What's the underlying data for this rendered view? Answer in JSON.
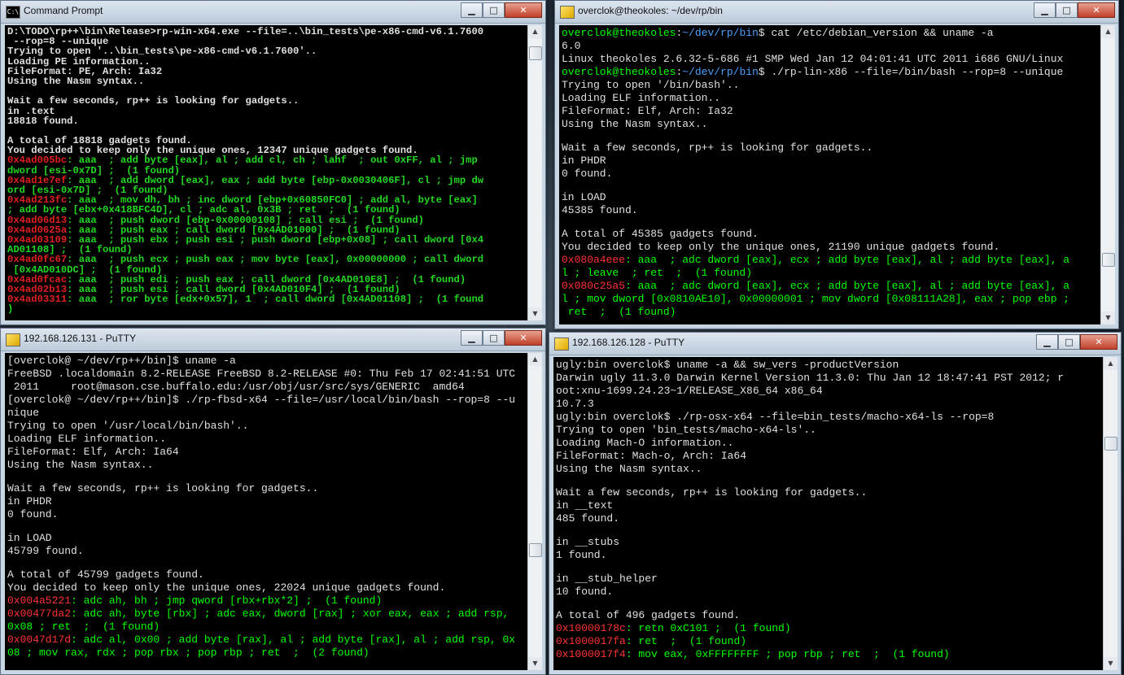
{
  "windows": {
    "cmd": {
      "title": "Command Prompt",
      "lines": [
        [
          [
            "w",
            "D:\\TODO\\rp++\\bin\\Release>rp-win-x64.exe --file=..\\bin_tests\\pe-x86-cmd-v6.1.7600"
          ]
        ],
        [
          [
            "w",
            " --rop=8 --unique"
          ]
        ],
        [
          [
            "w",
            "Trying to open '..\\bin_tests\\pe-x86-cmd-v6.1.7600'.."
          ]
        ],
        [
          [
            "w",
            "Loading PE information.."
          ]
        ],
        [
          [
            "w",
            "FileFormat: PE, Arch: Ia32"
          ]
        ],
        [
          [
            "w",
            "Using the Nasm syntax.."
          ]
        ],
        [
          [
            "w",
            ""
          ]
        ],
        [
          [
            "w",
            "Wait a few seconds, rp++ is looking for gadgets.."
          ]
        ],
        [
          [
            "w",
            "in .text"
          ]
        ],
        [
          [
            "w",
            "18818 found."
          ]
        ],
        [
          [
            "w",
            ""
          ]
        ],
        [
          [
            "w",
            "A total of 18818 gadgets found."
          ]
        ],
        [
          [
            "w",
            "You decided to keep only the unique ones, 12347 unique gadgets found."
          ]
        ],
        [
          [
            "cr",
            "0x4ad005bc"
          ],
          [
            "cg",
            ": aaa  ; add byte [eax], al ; add cl, ch ; lahf  ; out 0xFF, al ; jmp"
          ]
        ],
        [
          [
            "cg",
            "dword [esi-0x7D] ;  (1 found)"
          ]
        ],
        [
          [
            "cr",
            "0x4ad1e7ef"
          ],
          [
            "cg",
            ": aaa  ; add dword [eax], eax ; add byte [ebp-0x0030406F], cl ; jmp dw"
          ]
        ],
        [
          [
            "cg",
            "ord [esi-0x7D] ;  (1 found)"
          ]
        ],
        [
          [
            "cr",
            "0x4ad213fc"
          ],
          [
            "cg",
            ": aaa  ; mov dh, bh ; inc dword [ebp+0x60850FC0] ; add al, byte [eax]"
          ]
        ],
        [
          [
            "cg",
            "; add byte [ebx+0x418BFC4D], cl ; adc al, 0x3B ; ret  ;  (1 found)"
          ]
        ],
        [
          [
            "cr",
            "0x4ad06d13"
          ],
          [
            "cg",
            ": aaa  ; push dword [ebp-0x00000108] ; call esi ;  (1 found)"
          ]
        ],
        [
          [
            "cr",
            "0x4ad0625a"
          ],
          [
            "cg",
            ": aaa  ; push eax ; call dword [0x4AD01000] ;  (1 found)"
          ]
        ],
        [
          [
            "cr",
            "0x4ad03109"
          ],
          [
            "cg",
            ": aaa  ; push ebx ; push esi ; push dword [ebp+0x08] ; call dword [0x4"
          ]
        ],
        [
          [
            "cg",
            "AD01108] ;  (1 found)"
          ]
        ],
        [
          [
            "cr",
            "0x4ad0fc67"
          ],
          [
            "cg",
            ": aaa  ; push ecx ; push eax ; mov byte [eax], 0x00000000 ; call dword"
          ]
        ],
        [
          [
            "cg",
            " [0x4AD010DC] ;  (1 found)"
          ]
        ],
        [
          [
            "cr",
            "0x4ad0fcac"
          ],
          [
            "cg",
            ": aaa  ; push edi ; push eax ; call dword [0x4AD010E8] ;  (1 found)"
          ]
        ],
        [
          [
            "cr",
            "0x4ad02b13"
          ],
          [
            "cg",
            ": aaa  ; push esi ; call dword [0x4AD010F4] ;  (1 found)"
          ]
        ],
        [
          [
            "cr",
            "0x4ad03311"
          ],
          [
            "cg",
            ": aaa  ; ror byte [edx+0x57], 1  ; call dword [0x4AD01108] ;  (1 found"
          ]
        ],
        [
          [
            "cg",
            ")"
          ]
        ]
      ]
    },
    "linux": {
      "title": "overclok@theokoles: ~/dev/rp/bin",
      "lines": [
        [
          [
            "g",
            "overclok@theokoles"
          ],
          [
            "w",
            ":"
          ],
          [
            "b",
            "~/dev/rp/bin"
          ],
          [
            "w",
            "$ cat /etc/debian_version && uname -a"
          ]
        ],
        [
          [
            "w",
            "6.0"
          ]
        ],
        [
          [
            "w",
            "Linux theokoles 2.6.32-5-686 #1 SMP Wed Jan 12 04:01:41 UTC 2011 i686 GNU/Linux"
          ]
        ],
        [
          [
            "g",
            "overclok@theokoles"
          ],
          [
            "w",
            ":"
          ],
          [
            "b",
            "~/dev/rp/bin"
          ],
          [
            "w",
            "$ ./rp-lin-x86 --file=/bin/bash --rop=8 --unique"
          ]
        ],
        [
          [
            "w",
            "Trying to open '/bin/bash'.."
          ]
        ],
        [
          [
            "w",
            "Loading ELF information.."
          ]
        ],
        [
          [
            "w",
            "FileFormat: Elf, Arch: Ia32"
          ]
        ],
        [
          [
            "w",
            "Using the Nasm syntax.."
          ]
        ],
        [
          [
            "w",
            ""
          ]
        ],
        [
          [
            "w",
            "Wait a few seconds, rp++ is looking for gadgets.."
          ]
        ],
        [
          [
            "w",
            "in PHDR"
          ]
        ],
        [
          [
            "w",
            "0 found."
          ]
        ],
        [
          [
            "w",
            ""
          ]
        ],
        [
          [
            "w",
            "in LOAD"
          ]
        ],
        [
          [
            "w",
            "45385 found."
          ]
        ],
        [
          [
            "w",
            ""
          ]
        ],
        [
          [
            "w",
            "A total of 45385 gadgets found."
          ]
        ],
        [
          [
            "w",
            "You decided to keep only the unique ones, 21190 unique gadgets found."
          ]
        ],
        [
          [
            "r",
            "0x080a4eee"
          ],
          [
            "g",
            ": aaa  ; adc dword [eax], ecx ; add byte [eax], al ; add byte [eax], a"
          ]
        ],
        [
          [
            "g",
            "l ; leave  ; ret  ;  (1 found)"
          ]
        ],
        [
          [
            "r",
            "0x080c25a5"
          ],
          [
            "g",
            ": aaa  ; adc dword [eax], ecx ; add byte [eax], al ; add byte [eax], a"
          ]
        ],
        [
          [
            "g",
            "l ; mov dword [0x0810AE10], 0x00000001 ; mov dword [0x08111A28], eax ; pop ebp ;"
          ]
        ],
        [
          [
            "g",
            " ret  ;  (1 found)"
          ]
        ]
      ]
    },
    "bsd": {
      "title": "192.168.126.131 - PuTTY",
      "lines": [
        [
          [
            "w",
            "[overclok@ ~/dev/rp++/bin]$ uname -a"
          ]
        ],
        [
          [
            "w",
            "FreeBSD .localdomain 8.2-RELEASE FreeBSD 8.2-RELEASE #0: Thu Feb 17 02:41:51 UTC"
          ]
        ],
        [
          [
            "w",
            " 2011     root@mason.cse.buffalo.edu:/usr/obj/usr/src/sys/GENERIC  amd64"
          ]
        ],
        [
          [
            "w",
            "[overclok@ ~/dev/rp++/bin]$ ./rp-fbsd-x64 --file=/usr/local/bin/bash --rop=8 --u"
          ]
        ],
        [
          [
            "w",
            "nique"
          ]
        ],
        [
          [
            "w",
            "Trying to open '/usr/local/bin/bash'.."
          ]
        ],
        [
          [
            "w",
            "Loading ELF information.."
          ]
        ],
        [
          [
            "w",
            "FileFormat: Elf, Arch: Ia64"
          ]
        ],
        [
          [
            "w",
            "Using the Nasm syntax.."
          ]
        ],
        [
          [
            "w",
            ""
          ]
        ],
        [
          [
            "w",
            "Wait a few seconds, rp++ is looking for gadgets.."
          ]
        ],
        [
          [
            "w",
            "in PHDR"
          ]
        ],
        [
          [
            "w",
            "0 found."
          ]
        ],
        [
          [
            "w",
            ""
          ]
        ],
        [
          [
            "w",
            "in LOAD"
          ]
        ],
        [
          [
            "w",
            "45799 found."
          ]
        ],
        [
          [
            "w",
            ""
          ]
        ],
        [
          [
            "w",
            "A total of 45799 gadgets found."
          ]
        ],
        [
          [
            "w",
            "You decided to keep only the unique ones, 22024 unique gadgets found."
          ]
        ],
        [
          [
            "r",
            "0x004a5221"
          ],
          [
            "g",
            ": adc ah, bh ; jmp qword [rbx+rbx*2] ;  (1 found)"
          ]
        ],
        [
          [
            "r",
            "0x00477da2"
          ],
          [
            "g",
            ": adc ah, byte [rbx] ; adc eax, dword [rax] ; xor eax, eax ; add rsp,"
          ]
        ],
        [
          [
            "g",
            "0x08 ; ret  ;  (1 found)"
          ]
        ],
        [
          [
            "r",
            "0x0047d17d"
          ],
          [
            "g",
            ": adc al, 0x00 ; add byte [rax], al ; add byte [rax], al ; add rsp, 0x"
          ]
        ],
        [
          [
            "g",
            "08 ; mov rax, rdx ; pop rbx ; pop rbp ; ret  ;  (2 found)"
          ]
        ]
      ]
    },
    "osx": {
      "title": "192.168.126.128 - PuTTY",
      "lines": [
        [
          [
            "w",
            "ugly:bin overclok$ uname -a && sw_vers -productVersion"
          ]
        ],
        [
          [
            "w",
            "Darwin ugly 11.3.0 Darwin Kernel Version 11.3.0: Thu Jan 12 18:47:41 PST 2012; r"
          ]
        ],
        [
          [
            "w",
            "oot:xnu-1699.24.23~1/RELEASE_X86_64 x86_64"
          ]
        ],
        [
          [
            "w",
            "10.7.3"
          ]
        ],
        [
          [
            "w",
            "ugly:bin overclok$ ./rp-osx-x64 --file=bin_tests/macho-x64-ls --rop=8"
          ]
        ],
        [
          [
            "w",
            "Trying to open 'bin_tests/macho-x64-ls'.."
          ]
        ],
        [
          [
            "w",
            "Loading Mach-O information.."
          ]
        ],
        [
          [
            "w",
            "FileFormat: Mach-o, Arch: Ia64"
          ]
        ],
        [
          [
            "w",
            "Using the Nasm syntax.."
          ]
        ],
        [
          [
            "w",
            ""
          ]
        ],
        [
          [
            "w",
            "Wait a few seconds, rp++ is looking for gadgets.."
          ]
        ],
        [
          [
            "w",
            "in __text"
          ]
        ],
        [
          [
            "w",
            "485 found."
          ]
        ],
        [
          [
            "w",
            ""
          ]
        ],
        [
          [
            "w",
            "in __stubs"
          ]
        ],
        [
          [
            "w",
            "1 found."
          ]
        ],
        [
          [
            "w",
            ""
          ]
        ],
        [
          [
            "w",
            "in __stub_helper"
          ]
        ],
        [
          [
            "w",
            "10 found."
          ]
        ],
        [
          [
            "w",
            ""
          ]
        ],
        [
          [
            "w",
            "A total of 496 gadgets found."
          ]
        ],
        [
          [
            "r",
            "0x10000178c"
          ],
          [
            "g",
            ": retn 0xC101 ;  (1 found)"
          ]
        ],
        [
          [
            "r",
            "0x1000017fa"
          ],
          [
            "g",
            ": ret  ;  (1 found)"
          ]
        ],
        [
          [
            "r",
            "0x1000017f4"
          ],
          [
            "g",
            ": mov eax, 0xFFFFFFFF ; pop rbp ; ret  ;  (1 found)"
          ]
        ]
      ]
    }
  },
  "controls": {
    "minimize": "▁",
    "maximize": "□",
    "close": "✕"
  },
  "icons": {
    "cmd": "C:\\",
    "putty": "putty-icon"
  },
  "colors": {
    "prompt_green": "#00ff00",
    "address_red": "#ff3333",
    "path_blue": "#4aa0ff"
  }
}
